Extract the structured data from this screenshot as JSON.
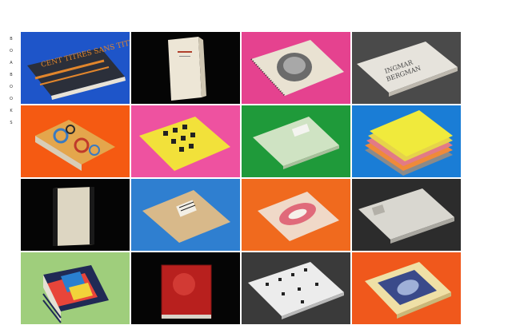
{
  "nav": {
    "letters": [
      "B",
      "O",
      "A",
      "B",
      "O",
      "O",
      "K",
      "S"
    ]
  },
  "gallery": {
    "tiles": [
      {
        "bg": "#1e55c9",
        "subject": "book-dark-blue-orange-title-icon"
      },
      {
        "bg": "#050505",
        "subject": "book-white-standing-icon"
      },
      {
        "bg": "#e5428f",
        "subject": "book-portrait-spiral-icon"
      },
      {
        "bg": "#4a4a4a",
        "subject": "book-ingmar-bergman-icon"
      },
      {
        "bg": "#f55a12",
        "subject": "book-patterned-orange-icon"
      },
      {
        "bg": "#ee52a0",
        "subject": "book-yellow-squares-icon"
      },
      {
        "bg": "#1f9a3a",
        "subject": "book-pale-green-icon"
      },
      {
        "bg": "#1a7dd6",
        "subject": "book-stacked-colors-icon"
      },
      {
        "bg": "#050505",
        "subject": "book-slipcase-icon"
      },
      {
        "bg": "#2f7fd0",
        "subject": "book-kraft-cover-icon"
      },
      {
        "bg": "#f06a1e",
        "subject": "book-pink-label-icon"
      },
      {
        "bg": "#2c2c2c",
        "subject": "book-grey-pages-icon"
      },
      {
        "bg": "#9fce7c",
        "subject": "book-stack-abstract-icon"
      },
      {
        "bg": "#050505",
        "subject": "book-red-cover-icon"
      },
      {
        "bg": "#3a3a3a",
        "subject": "book-white-letters-icon"
      },
      {
        "bg": "#f0581c",
        "subject": "book-blue-photo-icon"
      }
    ],
    "book_titles": {
      "tile1": "CENT TITRES SANS TITRE",
      "tile4_line1": "INGMAR",
      "tile4_line2": "BERGMAN"
    }
  }
}
